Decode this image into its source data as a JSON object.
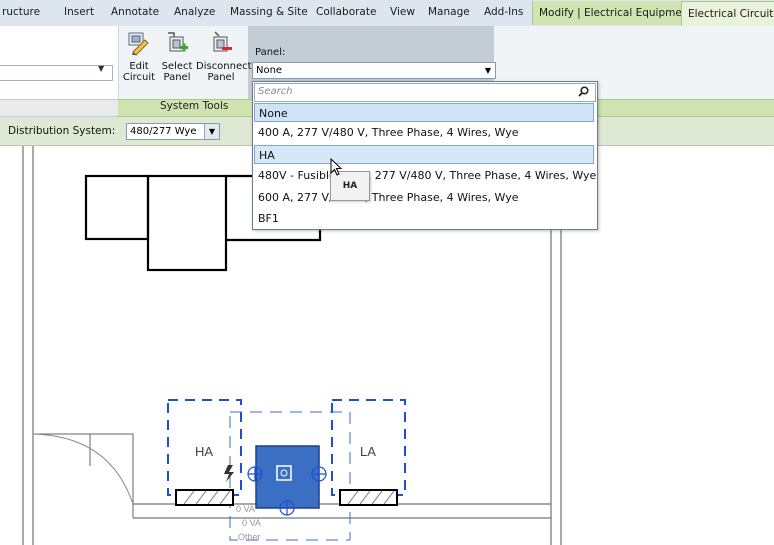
{
  "ribbon": {
    "tabs": [
      {
        "label": "ructure"
      },
      {
        "label": "Insert"
      },
      {
        "label": "Annotate"
      },
      {
        "label": "Analyze"
      },
      {
        "label": "Massing & Site"
      },
      {
        "label": "Collaborate"
      },
      {
        "label": "View"
      },
      {
        "label": "Manage"
      },
      {
        "label": "Add-Ins"
      },
      {
        "label": "Modify | Electrical Equipment"
      },
      {
        "label": "Electrical Circuits"
      }
    ],
    "tools": {
      "edit_circuit": "Edit\nCircuit",
      "select_panel": "Select\nPanel",
      "disconnect_panel": "Disconnect\nPanel"
    },
    "panel_label": "Panel:",
    "panel_value": "None",
    "group_caption": "System Tools"
  },
  "options_bar": {
    "distribution_label": "Distribution System:",
    "distribution_value": "480/277 Wye"
  },
  "dropdown": {
    "search_placeholder": "Search",
    "items": [
      "None",
      "400 A, 277 V/480 V, Three Phase, 4 Wires, Wye",
      "HA",
      "480V - Fusible 400A, 277 V/480 V, Three Phase, 4 Wires, Wye",
      "600 A, 277 V/480 V, Three Phase, 4 Wires, Wye",
      "BF1"
    ],
    "tooltip": "HA"
  },
  "canvas": {
    "panel_ha": "HA",
    "panel_la": "LA",
    "tag_lines": [
      "0 VA",
      "0 VA",
      "Other"
    ]
  },
  "colors": {
    "context_tab": "#cfe4b0",
    "selection_blue": "#3a6fc4",
    "dashed_blue": "#1f4fd1"
  }
}
